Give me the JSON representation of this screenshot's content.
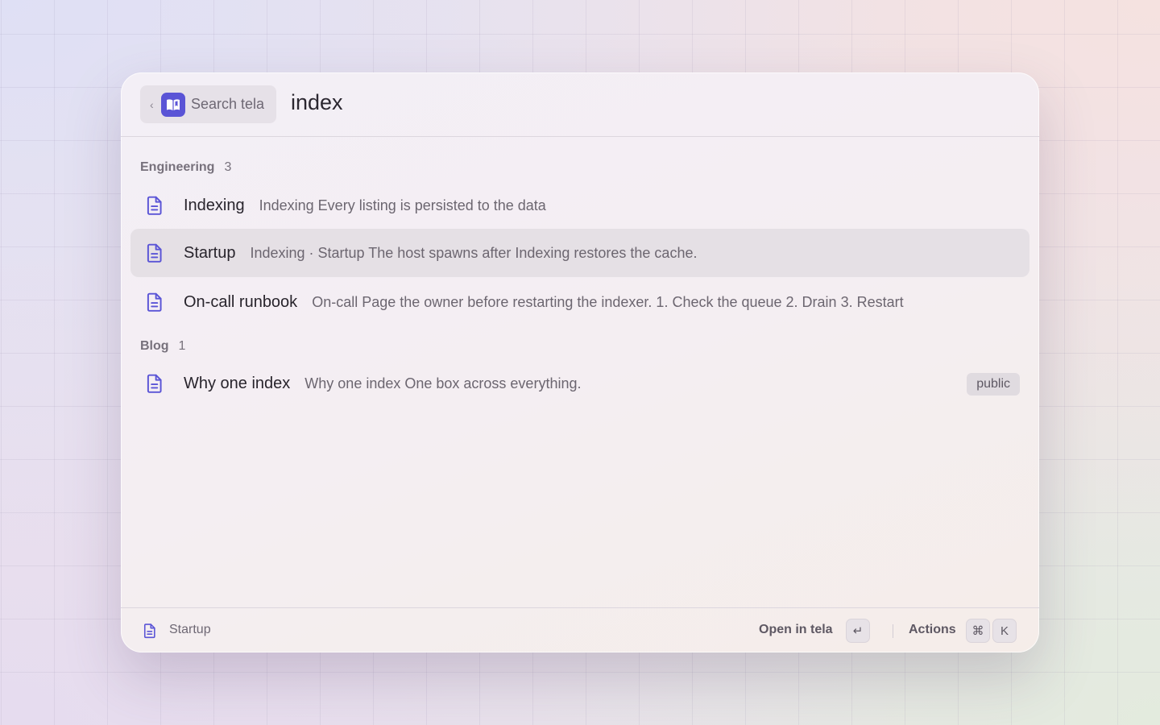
{
  "header": {
    "scope_label": "Search tela",
    "back_icon": "chevron-left-icon",
    "app_icon": "book-icon",
    "query": "index",
    "accent": "#5a54d6"
  },
  "sections": [
    {
      "title": "Engineering",
      "count": "3",
      "items": [
        {
          "title": "Indexing",
          "snippet": "Indexing Every listing is persisted to the data",
          "selected": false
        },
        {
          "title": "Startup",
          "snippet": "Indexing · Startup The host spawns after Indexing restores the cache.",
          "selected": true
        },
        {
          "title": "On-call runbook",
          "snippet": "On-call Page the owner before restarting the indexer. 1. Check the queue 2. Drain 3. Restart",
          "selected": false
        }
      ]
    },
    {
      "title": "Blog",
      "count": "1",
      "items": [
        {
          "title": "Why one index",
          "snippet": "Why one index One box across everything.",
          "badge": "public",
          "selected": false
        }
      ]
    }
  ],
  "footer": {
    "selected_item": "Startup",
    "primary_action": "Open in tela",
    "primary_key": "↵",
    "secondary_action": "Actions",
    "secondary_keys": [
      "⌘",
      "K"
    ]
  }
}
